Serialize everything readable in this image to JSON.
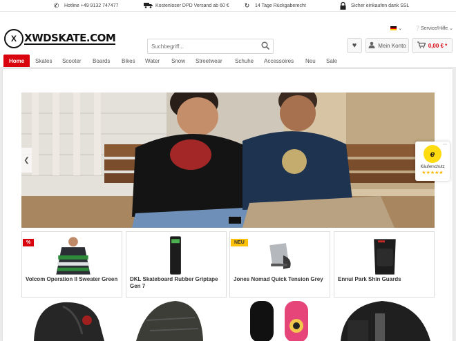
{
  "topbar": {
    "hotline": "Hotline +49 9132 747477",
    "shipping": "Kostenloser DPD Versand ab 60 €",
    "returns": "14 Tage Rückgaberecht",
    "ssl": "Sicher einkaufen dank SSL"
  },
  "header": {
    "logo_text": "XWDSKATE.COM",
    "service_label": "Service/Hilfe",
    "search_placeholder": "Suchbegriff...",
    "account_label": "Mein Konto",
    "cart_total": "0,00 € *"
  },
  "nav": [
    "Home",
    "Skates",
    "Scooter",
    "Boards",
    "Bikes",
    "Water",
    "Snow",
    "Streetwear",
    "Schuhe",
    "Accessoires",
    "Neu",
    "Sale"
  ],
  "trusted_shops": {
    "label": "Käuferschutz",
    "stars": "★★★★★"
  },
  "products": [
    {
      "name": "Volcom Operation II Sweater Green",
      "badge": "%"
    },
    {
      "name": "DKL Skateboard Rubber Griptape Gen 7",
      "badge": ""
    },
    {
      "name": "Jones Nomad Quick Tension Grey",
      "badge": "NEU"
    },
    {
      "name": "Ennui Park Shin Guards",
      "badge": ""
    }
  ],
  "colors": {
    "accent": "#d9030e",
    "new_badge": "#ffc107"
  }
}
